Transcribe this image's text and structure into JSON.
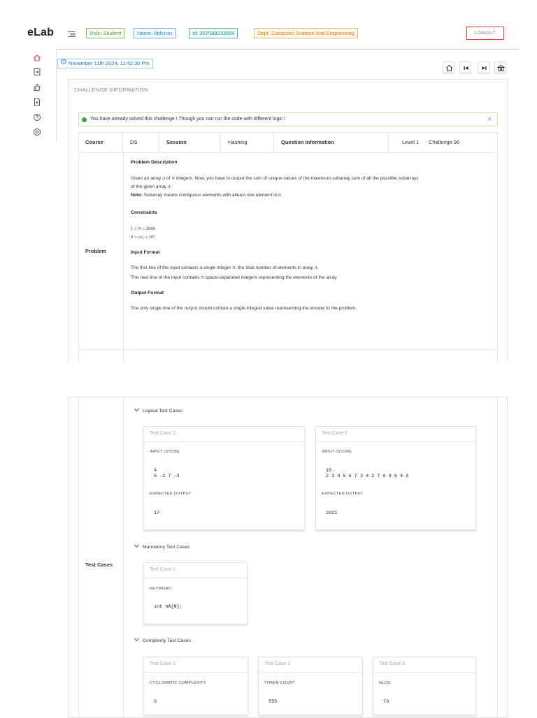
{
  "header": {
    "logo": "eLab",
    "role": "Role: Student",
    "name": "Name: Abhinav",
    "id": "Id: 307589233604",
    "dept": "Dept: Computer Science And Engineering",
    "logout": "LOGOUT"
  },
  "sidebar": {
    "icons": [
      "home-icon",
      "login-icon",
      "thumbs-up-icon",
      "document-icon",
      "help-icon",
      "settings-icon"
    ]
  },
  "toolbar": {
    "datetime": "November 11th 2024, 11:42:30 Pm",
    "nav_icons": [
      "home-icon",
      "skip-previous-icon",
      "skip-next-icon",
      "bank-icon"
    ]
  },
  "challenge": {
    "section_title": "CHALLENGE INFORMATION",
    "alert": "You have already solved this challenge ! Though you can run the code with different logic !",
    "course_label": "Course",
    "course_value": "DS",
    "session_label": "Session",
    "session_value": "Hashing",
    "question_label": "Question Information",
    "level": "Level 1",
    "challenge_no": "Challenge 96",
    "problem_label": "Problem",
    "problem": {
      "desc_title": "Problem Description",
      "desc_line1_a": "Given an array ",
      "desc_line1_b": " of ",
      "desc_line1_c": " integers. Now, you have to output the sum of unique values of the maximum subarray sum of all the possible subarrays",
      "desc_line2_a": "of the given array ",
      "desc_line2_b": ".",
      "note_label": "Note:",
      "note_text": " Subarray means contiguous elements with atleast one element in it.",
      "var_A": "A",
      "var_N": "N",
      "constraints_title": "Constraints",
      "constraint1": "1 ≤ N ≤ 2000",
      "constraint2": "0 ≤ |Aᵢ| ≤ 10⁹",
      "input_title": "Input Format",
      "input_line1_a": "The first line of the input contains a single integer ",
      "input_line1_b": ", the total number of elements in array ",
      "input_line1_c": ".",
      "input_line2_a": "The next line of the input contains ",
      "input_line2_b": " space-separated integers representing the elements of the array.",
      "output_title": "Output Format",
      "output_line": "The only single line of the output should contain a single integral value representing the answer to the problem."
    }
  },
  "testcases": {
    "label": "Test Cases",
    "logical_title": "Logical Test Cases",
    "logical": [
      {
        "title": "Test Case 1",
        "input_label": "INPUT (STDIN)",
        "input": "4\n5 -2 7 -3",
        "output_label": "EXPECTED OUTPUT",
        "output": "17"
      },
      {
        "title": "Test Case 2",
        "input_label": "INPUT (STDIN)",
        "input": "15\n2 3 4 5 6 7 3 4 2 7 6 8 6 4 9",
        "output_label": "EXPECTED OUTPUT",
        "output": "2021"
      }
    ],
    "mandatory_title": "Mandatory Test Cases",
    "mandatory": [
      {
        "title": "Test Case 1",
        "label": "KEYWORD",
        "value": "int hA[N];"
      }
    ],
    "complexity_title": "Complexity Test Cases",
    "complexity": [
      {
        "title": "Test Case 1",
        "label": "CYCLOMATIC COMPLEXITY",
        "value": "3"
      },
      {
        "title": "Test Case 2",
        "label": "TOKEN COUNT",
        "value": "555"
      },
      {
        "title": "Test Case 3",
        "label": "NLOC",
        "value": "73"
      }
    ]
  },
  "colors": {
    "accent_red": "#e53935",
    "link_blue": "#1976d2",
    "success_green": "#43a047"
  }
}
